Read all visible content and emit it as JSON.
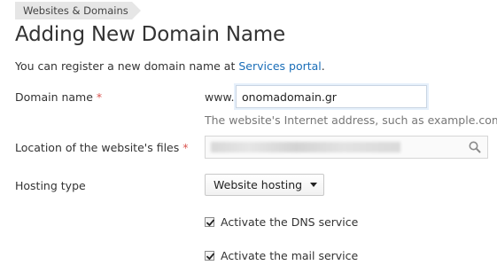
{
  "breadcrumb": {
    "label": "Websites & Domains"
  },
  "page": {
    "title": "Adding New Domain Name"
  },
  "intro": {
    "text": "You can register a new domain name at ",
    "link_label": "Services portal",
    "suffix": "."
  },
  "form": {
    "domain_name": {
      "label": "Domain name",
      "required_mark": "*",
      "prefix": "www.",
      "value": "onomadomain.gr",
      "hint": "The website's Internet address, such as example.com."
    },
    "location": {
      "label": "Location of the website's files",
      "required_mark": "*",
      "icon": "search-icon"
    },
    "hosting_type": {
      "label": "Hosting type",
      "selected": "Website hosting",
      "icon": "caret-down-icon"
    },
    "options": [
      {
        "label": "Activate the DNS service",
        "checked": true
      },
      {
        "label": "Activate the mail service",
        "checked": true
      }
    ]
  },
  "colors": {
    "link": "#1a6eb8",
    "required": "#d9534f",
    "hint": "#777777",
    "breadcrumb_bg": "#e6e6e6"
  }
}
